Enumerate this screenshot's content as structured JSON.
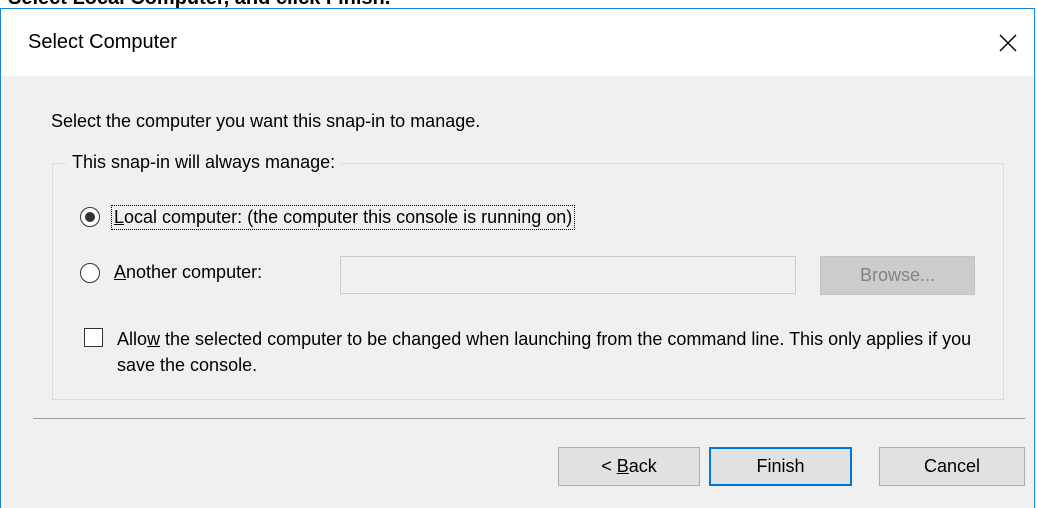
{
  "background_header_text": "Select Local Computer, and click Finish.",
  "dialog": {
    "title": "Select Computer",
    "instruction": "Select the computer you want this snap-in to manage.",
    "group_label": "This snap-in will always manage:",
    "options": [
      {
        "mnemonic": "L",
        "rest": "ocal computer:  (the computer this console is running on)",
        "selected": true
      },
      {
        "mnemonic": "A",
        "rest": "nother computer:",
        "selected": false
      }
    ],
    "another_computer_value": "",
    "browse_label": "Browse...",
    "checkbox": {
      "pre": "Allo",
      "mnemonic": "w",
      "post": " the selected computer to be changed when launching from the command line.  This only applies if you save the console.",
      "checked": false
    },
    "buttons": {
      "back_prefix": "< ",
      "back_mnemonic": "B",
      "back_rest": "ack",
      "finish": "Finish",
      "cancel": "Cancel"
    }
  },
  "icons": {
    "close": "close-icon"
  },
  "colors": {
    "accent": "#0078d7",
    "window_border": "#1883d7",
    "dialog_bg": "#f0f0f0"
  }
}
